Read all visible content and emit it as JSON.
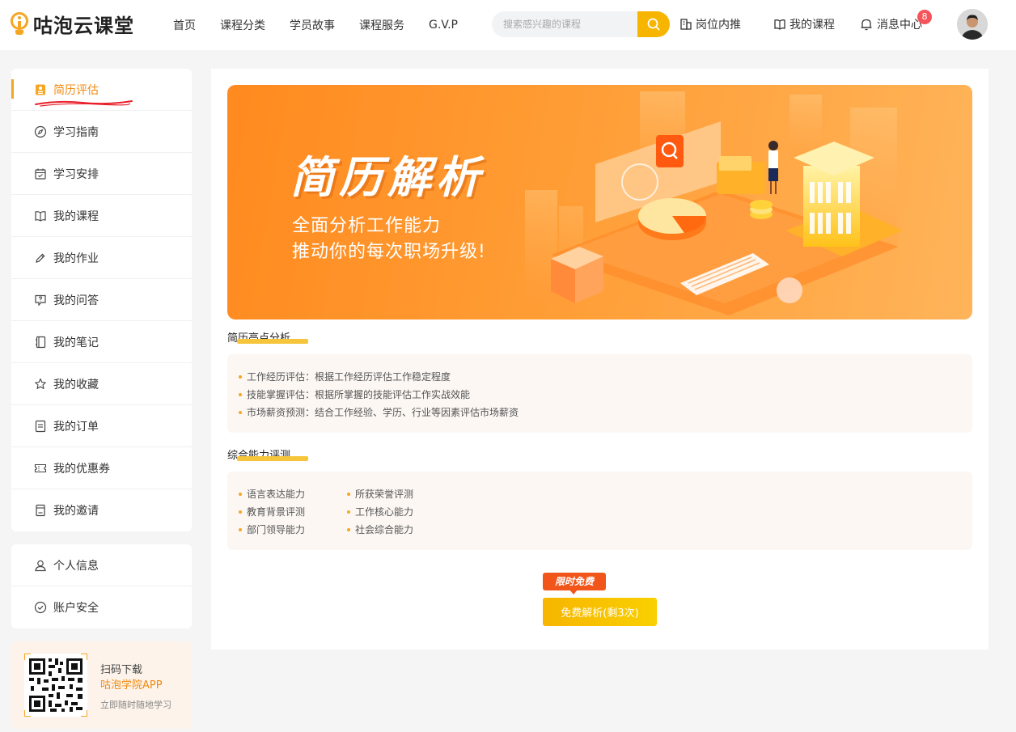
{
  "header": {
    "logo_text": "咕泡云课堂",
    "nav": [
      "首页",
      "课程分类",
      "学员故事",
      "课程服务",
      "G.V.P"
    ],
    "search_placeholder": "搜索感兴趣的课程",
    "links": {
      "referral": "岗位内推",
      "my_courses": "我的课程",
      "messages": "消息中心"
    },
    "message_count": "8"
  },
  "sidebar": {
    "groups": [
      [
        "简历评估",
        "学习指南",
        "学习安排",
        "我的课程",
        "我的作业",
        "我的问答",
        "我的笔记",
        "我的收藏",
        "我的订单",
        "我的优惠券",
        "我的邀请"
      ],
      [
        "个人信息",
        "账户安全"
      ]
    ],
    "active": "简历评估",
    "app_promo": {
      "title": "扫码下载",
      "name": "咕泡学院APP",
      "subtitle": "立即随时随地学习"
    }
  },
  "banner": {
    "title": "简历解析",
    "line1": "全面分析工作能力",
    "line2": "推动你的每次职场升级!"
  },
  "section1": {
    "title": "简历亮点分析",
    "items": [
      "工作经历评估：根据工作经历评估工作稳定程度",
      "技能掌握评估：根据所掌握的技能评估工作实战效能",
      "市场薪资预测：结合工作经验、学历、行业等因素评估市场薪资"
    ]
  },
  "section2": {
    "title": "综合能力评测",
    "col1": [
      "语言表达能力",
      "教育背景评测",
      "部门领导能力"
    ],
    "col2": [
      "所获荣誉评测",
      "工作核心能力",
      "社会综合能力"
    ]
  },
  "cta": {
    "tag": "限时免费",
    "button": "免费解析(剩3次)"
  },
  "colors": {
    "accent": "#f5a623",
    "active_text": "#f08a10",
    "badge": "#f5555a",
    "cta": "#f7b500"
  }
}
